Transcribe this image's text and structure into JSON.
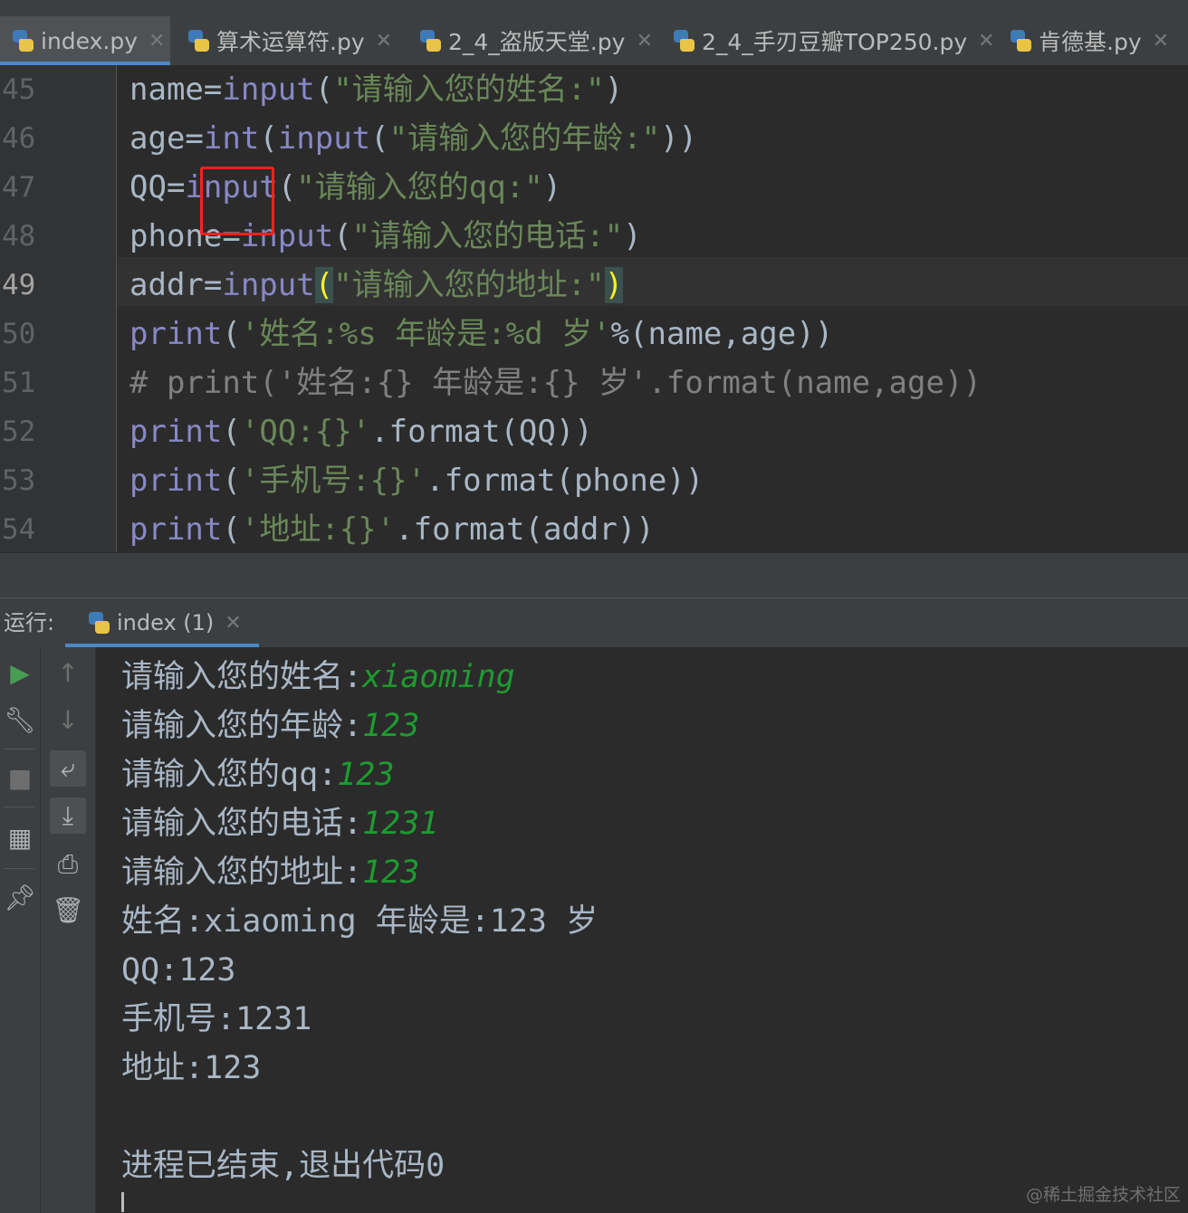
{
  "tabs": [
    {
      "label": "index.py",
      "active": true
    },
    {
      "label": "算术运算符.py",
      "active": false
    },
    {
      "label": "2_4_盗版天堂.py",
      "active": false
    },
    {
      "label": "2_4_手刃豆瓣TOP250.py",
      "active": false
    },
    {
      "label": "肯德基.py",
      "active": false
    }
  ],
  "editor": {
    "line_numbers": [
      "45",
      "46",
      "47",
      "48",
      "49",
      "50",
      "51",
      "52",
      "53",
      "54"
    ],
    "current_line": "49",
    "lines": [
      [
        {
          "t": "name=",
          "c": ""
        },
        {
          "t": "input",
          "c": "fn"
        },
        {
          "t": "(",
          "c": ""
        },
        {
          "t": "\"请输入您的姓名:\"",
          "c": "str"
        },
        {
          "t": ")",
          "c": ""
        }
      ],
      [
        {
          "t": "age=",
          "c": ""
        },
        {
          "t": "int",
          "c": "fn"
        },
        {
          "t": "(",
          "c": ""
        },
        {
          "t": "input",
          "c": "fn"
        },
        {
          "t": "(",
          "c": ""
        },
        {
          "t": "\"请输入您的年龄:\"",
          "c": "str"
        },
        {
          "t": "))",
          "c": ""
        }
      ],
      [
        {
          "t": "QQ=",
          "c": ""
        },
        {
          "t": "input",
          "c": "fn"
        },
        {
          "t": "(",
          "c": ""
        },
        {
          "t": "\"请输入您的qq:\"",
          "c": "str"
        },
        {
          "t": ")",
          "c": ""
        }
      ],
      [
        {
          "t": "phone=",
          "c": ""
        },
        {
          "t": "input",
          "c": "fn"
        },
        {
          "t": "(",
          "c": ""
        },
        {
          "t": "\"请输入您的电话:\"",
          "c": "str"
        },
        {
          "t": ")",
          "c": ""
        }
      ],
      [
        {
          "t": "addr=",
          "c": ""
        },
        {
          "t": "input",
          "c": "fn"
        },
        {
          "t": "(",
          "c": "match"
        },
        {
          "t": "\"请输入您的地址:\"",
          "c": "str"
        },
        {
          "t": ")",
          "c": "match"
        }
      ],
      [
        {
          "t": "print",
          "c": "fn"
        },
        {
          "t": "(",
          "c": ""
        },
        {
          "t": "'姓名:%s 年龄是:%d 岁'",
          "c": "str"
        },
        {
          "t": "%(name,age))",
          "c": ""
        }
      ],
      [
        {
          "t": "# print('姓名:{} 年龄是:{} 岁'.format(name,age))",
          "c": "cm"
        }
      ],
      [
        {
          "t": "print",
          "c": "fn"
        },
        {
          "t": "(",
          "c": ""
        },
        {
          "t": "'QQ:{}'",
          "c": "str"
        },
        {
          "t": ".format(QQ))",
          "c": ""
        }
      ],
      [
        {
          "t": "print",
          "c": "fn"
        },
        {
          "t": "(",
          "c": ""
        },
        {
          "t": "'手机号:{}'",
          "c": "str"
        },
        {
          "t": ".format(phone))",
          "c": ""
        }
      ],
      [
        {
          "t": "print",
          "c": "fn"
        },
        {
          "t": "(",
          "c": ""
        },
        {
          "t": "'地址:{}'",
          "c": "str"
        },
        {
          "t": ".format(addr))",
          "c": ""
        }
      ]
    ]
  },
  "run_panel": {
    "label": "运行:",
    "tab_label": "index (1)",
    "console_lines": [
      {
        "prompt": "请输入您的姓名:",
        "input": "xiaoming"
      },
      {
        "prompt": "请输入您的年龄:",
        "input": "123"
      },
      {
        "prompt": "请输入您的qq:",
        "input": "123"
      },
      {
        "prompt": "请输入您的电话:",
        "input": "1231"
      },
      {
        "prompt": "请输入您的地址:",
        "input": "123"
      },
      {
        "prompt": "姓名:xiaoming 年龄是:123 岁",
        "input": ""
      },
      {
        "prompt": "QQ:123",
        "input": ""
      },
      {
        "prompt": "手机号:1231",
        "input": ""
      },
      {
        "prompt": "地址:123",
        "input": ""
      },
      {
        "prompt": "",
        "input": ""
      },
      {
        "prompt": "进程已结束,退出代码0",
        "input": ""
      }
    ]
  },
  "watermark": "@稀土掘金技术社区",
  "colors": {
    "function": "#8888c6",
    "string": "#6a8759",
    "user_input": "#1d9b2f",
    "highlight_box": "#ff2020"
  }
}
